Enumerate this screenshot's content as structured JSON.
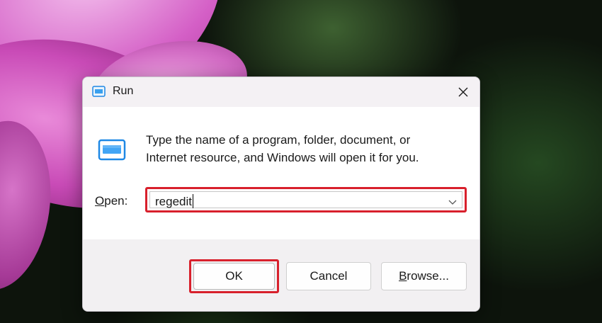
{
  "dialog": {
    "title": "Run",
    "description_line1": "Type the name of a program, folder, document, or",
    "description_line2": "Internet resource, and Windows will open it for you.",
    "open_label_accel": "O",
    "open_label_rest": "pen:",
    "open_value": "regedit",
    "ok_label": "OK",
    "cancel_label": "Cancel",
    "browse_label_accel": "B",
    "browse_label_rest": "rowse..."
  },
  "icons": {
    "title": "run-icon",
    "main": "run-program-icon",
    "close": "close-icon",
    "dropdown": "chevron-down-icon"
  },
  "colors": {
    "highlight": "#d8202c",
    "icon_blue": "#1e88e5"
  }
}
